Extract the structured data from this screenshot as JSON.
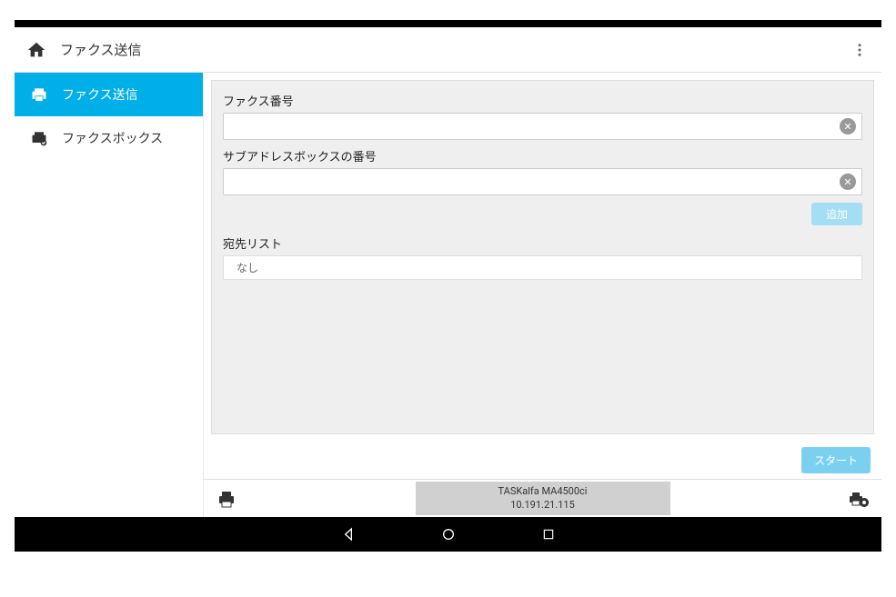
{
  "header": {
    "title": "ファクス送信"
  },
  "sidebar": {
    "items": [
      {
        "label": "ファクス送信",
        "active": true
      },
      {
        "label": "ファクスボックス",
        "active": false
      }
    ]
  },
  "form": {
    "fax_number_label": "ファクス番号",
    "fax_number_value": "",
    "subaddress_label": "サブアドレスボックスの番号",
    "subaddress_value": "",
    "add_button": "追加",
    "dest_list_label": "宛先リスト",
    "dest_list_empty": "なし"
  },
  "actions": {
    "start_button": "スタート"
  },
  "footer": {
    "device_name": "TASKalfa MA4500ci",
    "device_ip": "10.191.21.115"
  },
  "colors": {
    "accent": "#00aee8",
    "accent_light": "#7bd0f0",
    "accent_lighter": "#a5ddf2"
  }
}
